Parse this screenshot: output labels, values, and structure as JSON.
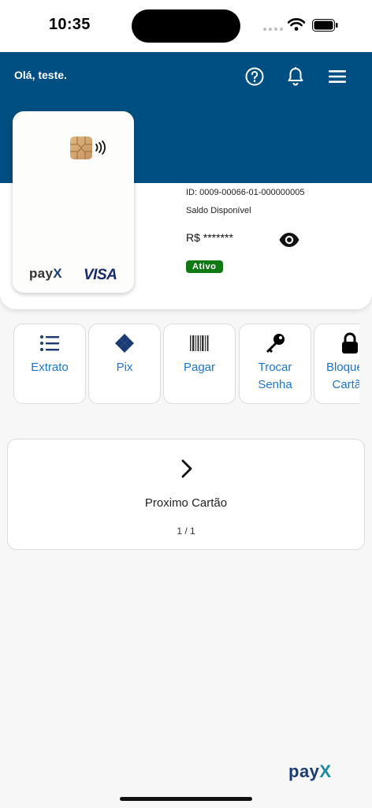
{
  "status": {
    "time": "10:35"
  },
  "header": {
    "greeting": "Olá, teste.",
    "icons": [
      "help-icon",
      "bell-icon",
      "menu-icon"
    ],
    "color": "#004f82"
  },
  "card": {
    "brand": "pay",
    "brand_x": "X",
    "network": "VISA"
  },
  "account": {
    "id": "ID: 0009-00066-01-000000005",
    "balance_label": "Saldo Disponível",
    "balance": "R$ *******",
    "status": "Ativo",
    "status_color": "#0f7a14"
  },
  "actions": [
    {
      "label": "Extrato",
      "icon": "list-icon"
    },
    {
      "label": "Pix",
      "icon": "pix-icon"
    },
    {
      "label": "Pagar",
      "icon": "barcode-icon"
    },
    {
      "label": "Trocar Senha",
      "icon": "key-icon"
    },
    {
      "label": "Bloquear Cartão",
      "icon": "lock-icon"
    }
  ],
  "next_card": {
    "label": "Proximo Cartão",
    "page": "1 / 1"
  },
  "footer": {
    "brand": "pay",
    "brand_x": "X"
  },
  "colors": {
    "accent": "#1976d2"
  }
}
